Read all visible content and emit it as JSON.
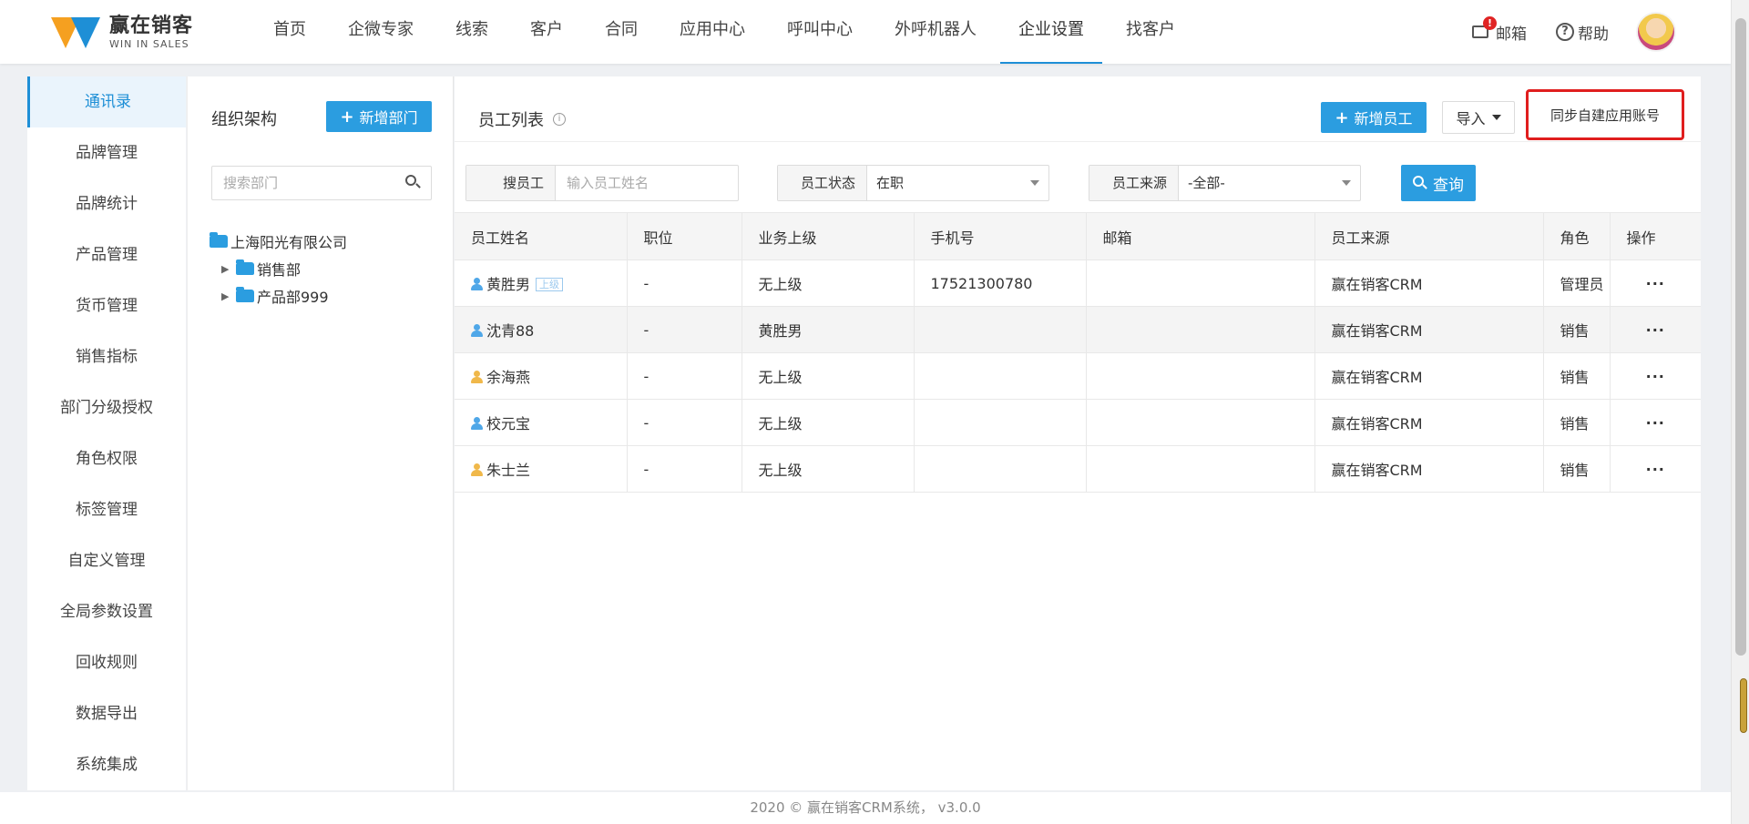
{
  "header": {
    "logo_cn": "赢在销客",
    "logo_en": "WIN IN SALES",
    "nav": [
      "首页",
      "企微专家",
      "线索",
      "客户",
      "合同",
      "应用中心",
      "呼叫中心",
      "外呼机器人",
      "企业设置",
      "找客户"
    ],
    "active_nav": "企业设置",
    "mail_label": "邮箱",
    "mail_badge": "!",
    "help_label": "帮助",
    "help_glyph": "?"
  },
  "sidebar": {
    "items": [
      "通讯录",
      "品牌管理",
      "品牌统计",
      "产品管理",
      "货币管理",
      "销售指标",
      "部门分级授权",
      "角色权限",
      "标签管理",
      "自定义管理",
      "全局参数设置",
      "回收规则",
      "数据导出",
      "系统集成"
    ],
    "active": "通讯录"
  },
  "org": {
    "title": "组织架构",
    "add_label": "新增部门",
    "search_placeholder": "搜索部门",
    "company": "上海阳光有限公司",
    "departments": [
      "销售部",
      "产品部999"
    ]
  },
  "employees": {
    "title": "员工列表",
    "info_glyph": "i",
    "add_label": "新增员工",
    "import_label": "导入",
    "sync_label": "同步自建应用账号",
    "filters": {
      "name_label": "搜员工",
      "name_placeholder": "输入员工姓名",
      "status_label": "员工状态",
      "status_value": "在职",
      "source_label": "员工来源",
      "source_value": "-全部-",
      "query_label": "查询"
    },
    "columns": [
      "员工姓名",
      "职位",
      "业务上级",
      "手机号",
      "邮箱",
      "员工来源",
      "角色",
      "操作"
    ],
    "rows": [
      {
        "name": "黄胜男",
        "tag": "上级",
        "icon": "blue",
        "position": "-",
        "superior": "无上级",
        "phone": "17521300780",
        "email": "",
        "source": "赢在销客CRM",
        "role": "管理员",
        "ops": "···"
      },
      {
        "name": "沈青88",
        "tag": "",
        "icon": "blue",
        "position": "-",
        "superior": "黄胜男",
        "phone": "",
        "email": "",
        "source": "赢在销客CRM",
        "role": "销售",
        "ops": "···"
      },
      {
        "name": "余海燕",
        "tag": "",
        "icon": "yellow",
        "position": "-",
        "superior": "无上级",
        "phone": "",
        "email": "",
        "source": "赢在销客CRM",
        "role": "销售",
        "ops": "···"
      },
      {
        "name": "校元宝",
        "tag": "",
        "icon": "blue",
        "position": "-",
        "superior": "无上级",
        "phone": "",
        "email": "",
        "source": "赢在销客CRM",
        "role": "销售",
        "ops": "···"
      },
      {
        "name": "朱士兰",
        "tag": "",
        "icon": "yellow",
        "position": "-",
        "superior": "无上级",
        "phone": "",
        "email": "",
        "source": "赢在销客CRM",
        "role": "销售",
        "ops": "···"
      }
    ]
  },
  "footer": {
    "text": "2020 © 赢在销客CRM系统， v3.0.0"
  },
  "colors": {
    "accent": "#2b9de0",
    "highlight_border": "#e01e1e",
    "badge": "#e02424"
  }
}
